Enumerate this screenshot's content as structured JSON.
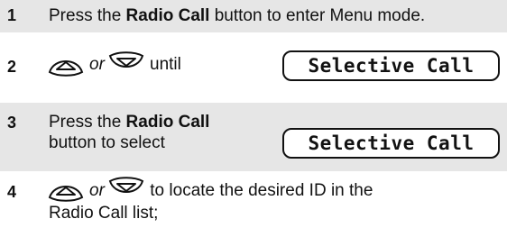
{
  "steps": [
    {
      "number": "1",
      "pre": "Press the ",
      "bold": "Radio Call",
      "post": " button to enter Menu mode."
    },
    {
      "number": "2",
      "or_word": "or",
      "until_word": "until",
      "display": "Selective Call",
      "icons": [
        "scroll-up-key-icon",
        "scroll-down-key-icon"
      ]
    },
    {
      "number": "3",
      "line1_pre": "Press the ",
      "line1_bold": "Radio Call",
      "line2": "button to select",
      "display": "Selective Call"
    },
    {
      "number": "4",
      "or_word": "or",
      "post": " to locate the desired ID in the",
      "line2": "Radio Call list;",
      "icons": [
        "scroll-up-key-icon",
        "scroll-down-key-icon"
      ]
    }
  ],
  "colors": {
    "shading": "#e6e6e6",
    "text": "#111111"
  }
}
